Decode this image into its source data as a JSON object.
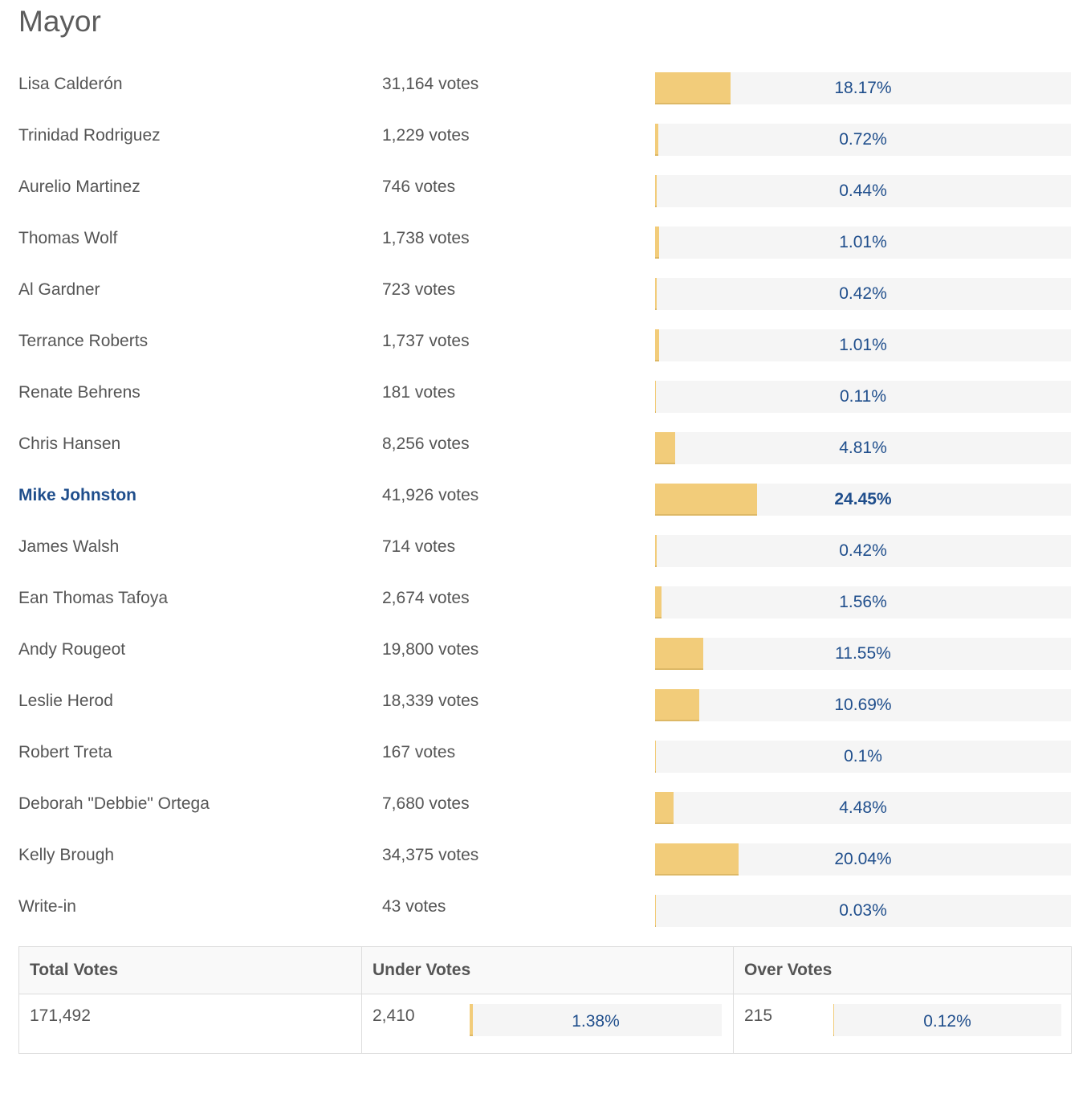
{
  "title": "Mayor",
  "candidates": [
    {
      "name": "Lisa Calderón",
      "votes": "31,164 votes",
      "percent_label": "18.17%",
      "percent": 18.17,
      "winner": false
    },
    {
      "name": "Trinidad Rodriguez",
      "votes": "1,229 votes",
      "percent_label": "0.72%",
      "percent": 0.72,
      "winner": false
    },
    {
      "name": "Aurelio Martinez",
      "votes": "746 votes",
      "percent_label": "0.44%",
      "percent": 0.44,
      "winner": false
    },
    {
      "name": "Thomas Wolf",
      "votes": "1,738 votes",
      "percent_label": "1.01%",
      "percent": 1.01,
      "winner": false
    },
    {
      "name": "Al Gardner",
      "votes": "723 votes",
      "percent_label": "0.42%",
      "percent": 0.42,
      "winner": false
    },
    {
      "name": "Terrance Roberts",
      "votes": "1,737 votes",
      "percent_label": "1.01%",
      "percent": 1.01,
      "winner": false
    },
    {
      "name": "Renate Behrens",
      "votes": "181 votes",
      "percent_label": "0.11%",
      "percent": 0.11,
      "winner": false
    },
    {
      "name": "Chris Hansen",
      "votes": "8,256 votes",
      "percent_label": "4.81%",
      "percent": 4.81,
      "winner": false
    },
    {
      "name": "Mike Johnston",
      "votes": "41,926 votes",
      "percent_label": "24.45%",
      "percent": 24.45,
      "winner": true
    },
    {
      "name": "James Walsh",
      "votes": "714 votes",
      "percent_label": "0.42%",
      "percent": 0.42,
      "winner": false
    },
    {
      "name": "Ean Thomas Tafoya",
      "votes": "2,674 votes",
      "percent_label": "1.56%",
      "percent": 1.56,
      "winner": false
    },
    {
      "name": "Andy Rougeot",
      "votes": "19,800 votes",
      "percent_label": "11.55%",
      "percent": 11.55,
      "winner": false
    },
    {
      "name": "Leslie Herod",
      "votes": "18,339 votes",
      "percent_label": "10.69%",
      "percent": 10.69,
      "winner": false
    },
    {
      "name": "Robert Treta",
      "votes": "167 votes",
      "percent_label": "0.1%",
      "percent": 0.1,
      "winner": false
    },
    {
      "name": "Deborah \"Debbie\" Ortega",
      "votes": "7,680 votes",
      "percent_label": "4.48%",
      "percent": 4.48,
      "winner": false
    },
    {
      "name": "Kelly Brough",
      "votes": "34,375 votes",
      "percent_label": "20.04%",
      "percent": 20.04,
      "winner": false
    },
    {
      "name": "Write-in",
      "votes": "43 votes",
      "percent_label": "0.03%",
      "percent": 0.03,
      "winner": false
    }
  ],
  "summary": {
    "headers": [
      "Total Votes",
      "Under Votes",
      "Over Votes"
    ],
    "total_votes": "171,492",
    "under_votes": {
      "value": "2,410",
      "percent_label": "1.38%",
      "percent": 1.38
    },
    "over_votes": {
      "value": "215",
      "percent_label": "0.12%",
      "percent": 0.12
    }
  },
  "colors": {
    "bar_fill": "#f2cc7a",
    "bar_track": "#f5f5f5",
    "percent_text": "#1f4e8c",
    "winner_text": "#1f4e8c"
  },
  "chart_data": {
    "type": "bar",
    "title": "Mayor",
    "orientation": "horizontal",
    "categories": [
      "Lisa Calderón",
      "Trinidad Rodriguez",
      "Aurelio Martinez",
      "Thomas Wolf",
      "Al Gardner",
      "Terrance Roberts",
      "Renate Behrens",
      "Chris Hansen",
      "Mike Johnston",
      "James Walsh",
      "Ean Thomas Tafoya",
      "Andy Rougeot",
      "Leslie Herod",
      "Robert Treta",
      "Deborah \"Debbie\" Ortega",
      "Kelly Brough",
      "Write-in"
    ],
    "series": [
      {
        "name": "Votes",
        "values": [
          31164,
          1229,
          746,
          1738,
          723,
          1737,
          181,
          8256,
          41926,
          714,
          2674,
          19800,
          18339,
          167,
          7680,
          34375,
          43
        ]
      },
      {
        "name": "Percent",
        "values": [
          18.17,
          0.72,
          0.44,
          1.01,
          0.42,
          1.01,
          0.11,
          4.81,
          24.45,
          0.42,
          1.56,
          11.55,
          10.69,
          0.1,
          4.48,
          20.04,
          0.03
        ]
      }
    ],
    "xlabel": "",
    "ylabel": "",
    "xlim": [
      0,
      100
    ],
    "grid": false,
    "legend": "none"
  }
}
